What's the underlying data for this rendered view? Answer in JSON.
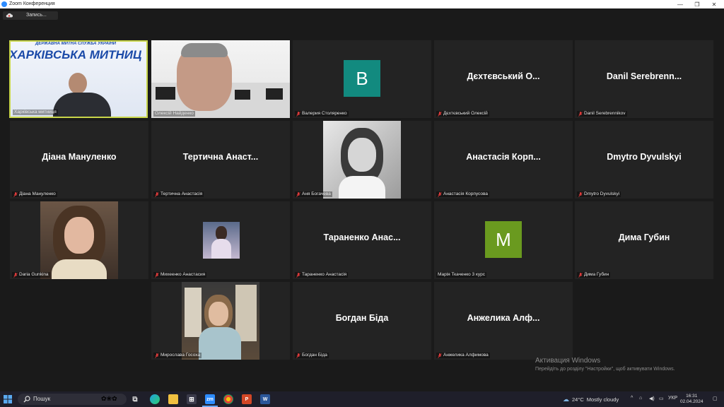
{
  "window": {
    "title": "Zoom Конференция"
  },
  "recording": {
    "label": "Запись..."
  },
  "tiles": [
    {
      "label": "Харківська митниця",
      "banner_top": "ДЕРЖАВНА МИТНА СЛУЖБА УКРАЇНИ",
      "banner_main": "ХАРКІВСЬКА МИТНИЦ"
    },
    {
      "label": "Олексій Найденко"
    },
    {
      "label": "Валерия Столяренко",
      "avatar_letter": "В",
      "avatar_color": "#128a7f"
    },
    {
      "label": "Дєхтєвський Олексій",
      "display": "Дєхтєвський О..."
    },
    {
      "label": "Danil Serebrennikov",
      "display": "Danil  Serebrenn..."
    },
    {
      "label": "Діана Мануленко",
      "display": "Діана Мануленко"
    },
    {
      "label": "Тертична Анастасія",
      "display": "Тертична  Анаст..."
    },
    {
      "label": "Аня Богачева"
    },
    {
      "label": "Анастасія Корпусова",
      "display": "Анастасія  Корп..."
    },
    {
      "label": "Dmytro Dyvulskyi",
      "display": "Dmytro Dyvulskyi"
    },
    {
      "label": "Daria Gunkina"
    },
    {
      "label": "Михеенко Анастасия"
    },
    {
      "label": "Тараненко Анастасія",
      "display": "Тараненко  Анас..."
    },
    {
      "label": "Марія Ткаченко 3 курс",
      "avatar_letter": "M",
      "avatar_color": "#6a9a1f"
    },
    {
      "label": "Дима Губин",
      "display": "Дима Губин"
    },
    {
      "label": "Мирослава Госоха"
    },
    {
      "label": "Богдан Біда",
      "display": "Богдан Біда"
    },
    {
      "label": "Анжелика Алфимова",
      "display": "Анжелика  Алф..."
    }
  ],
  "watermark": {
    "line1": "Активация Windows",
    "line2": "Перейдіть до розділу \"Настройки\", щоб активувати Windows."
  },
  "taskbar": {
    "search_label": "Пошук",
    "zoom_icon": "zm",
    "weather_temp": "24°C",
    "weather_text": "Mostly cloudy",
    "lang": "УКР",
    "time": "16:31",
    "date": "02.04.2024"
  },
  "colors": {
    "active_border": "#c9d64a",
    "muted_mic": "#e03b3b",
    "tile_bg": "#232323"
  }
}
